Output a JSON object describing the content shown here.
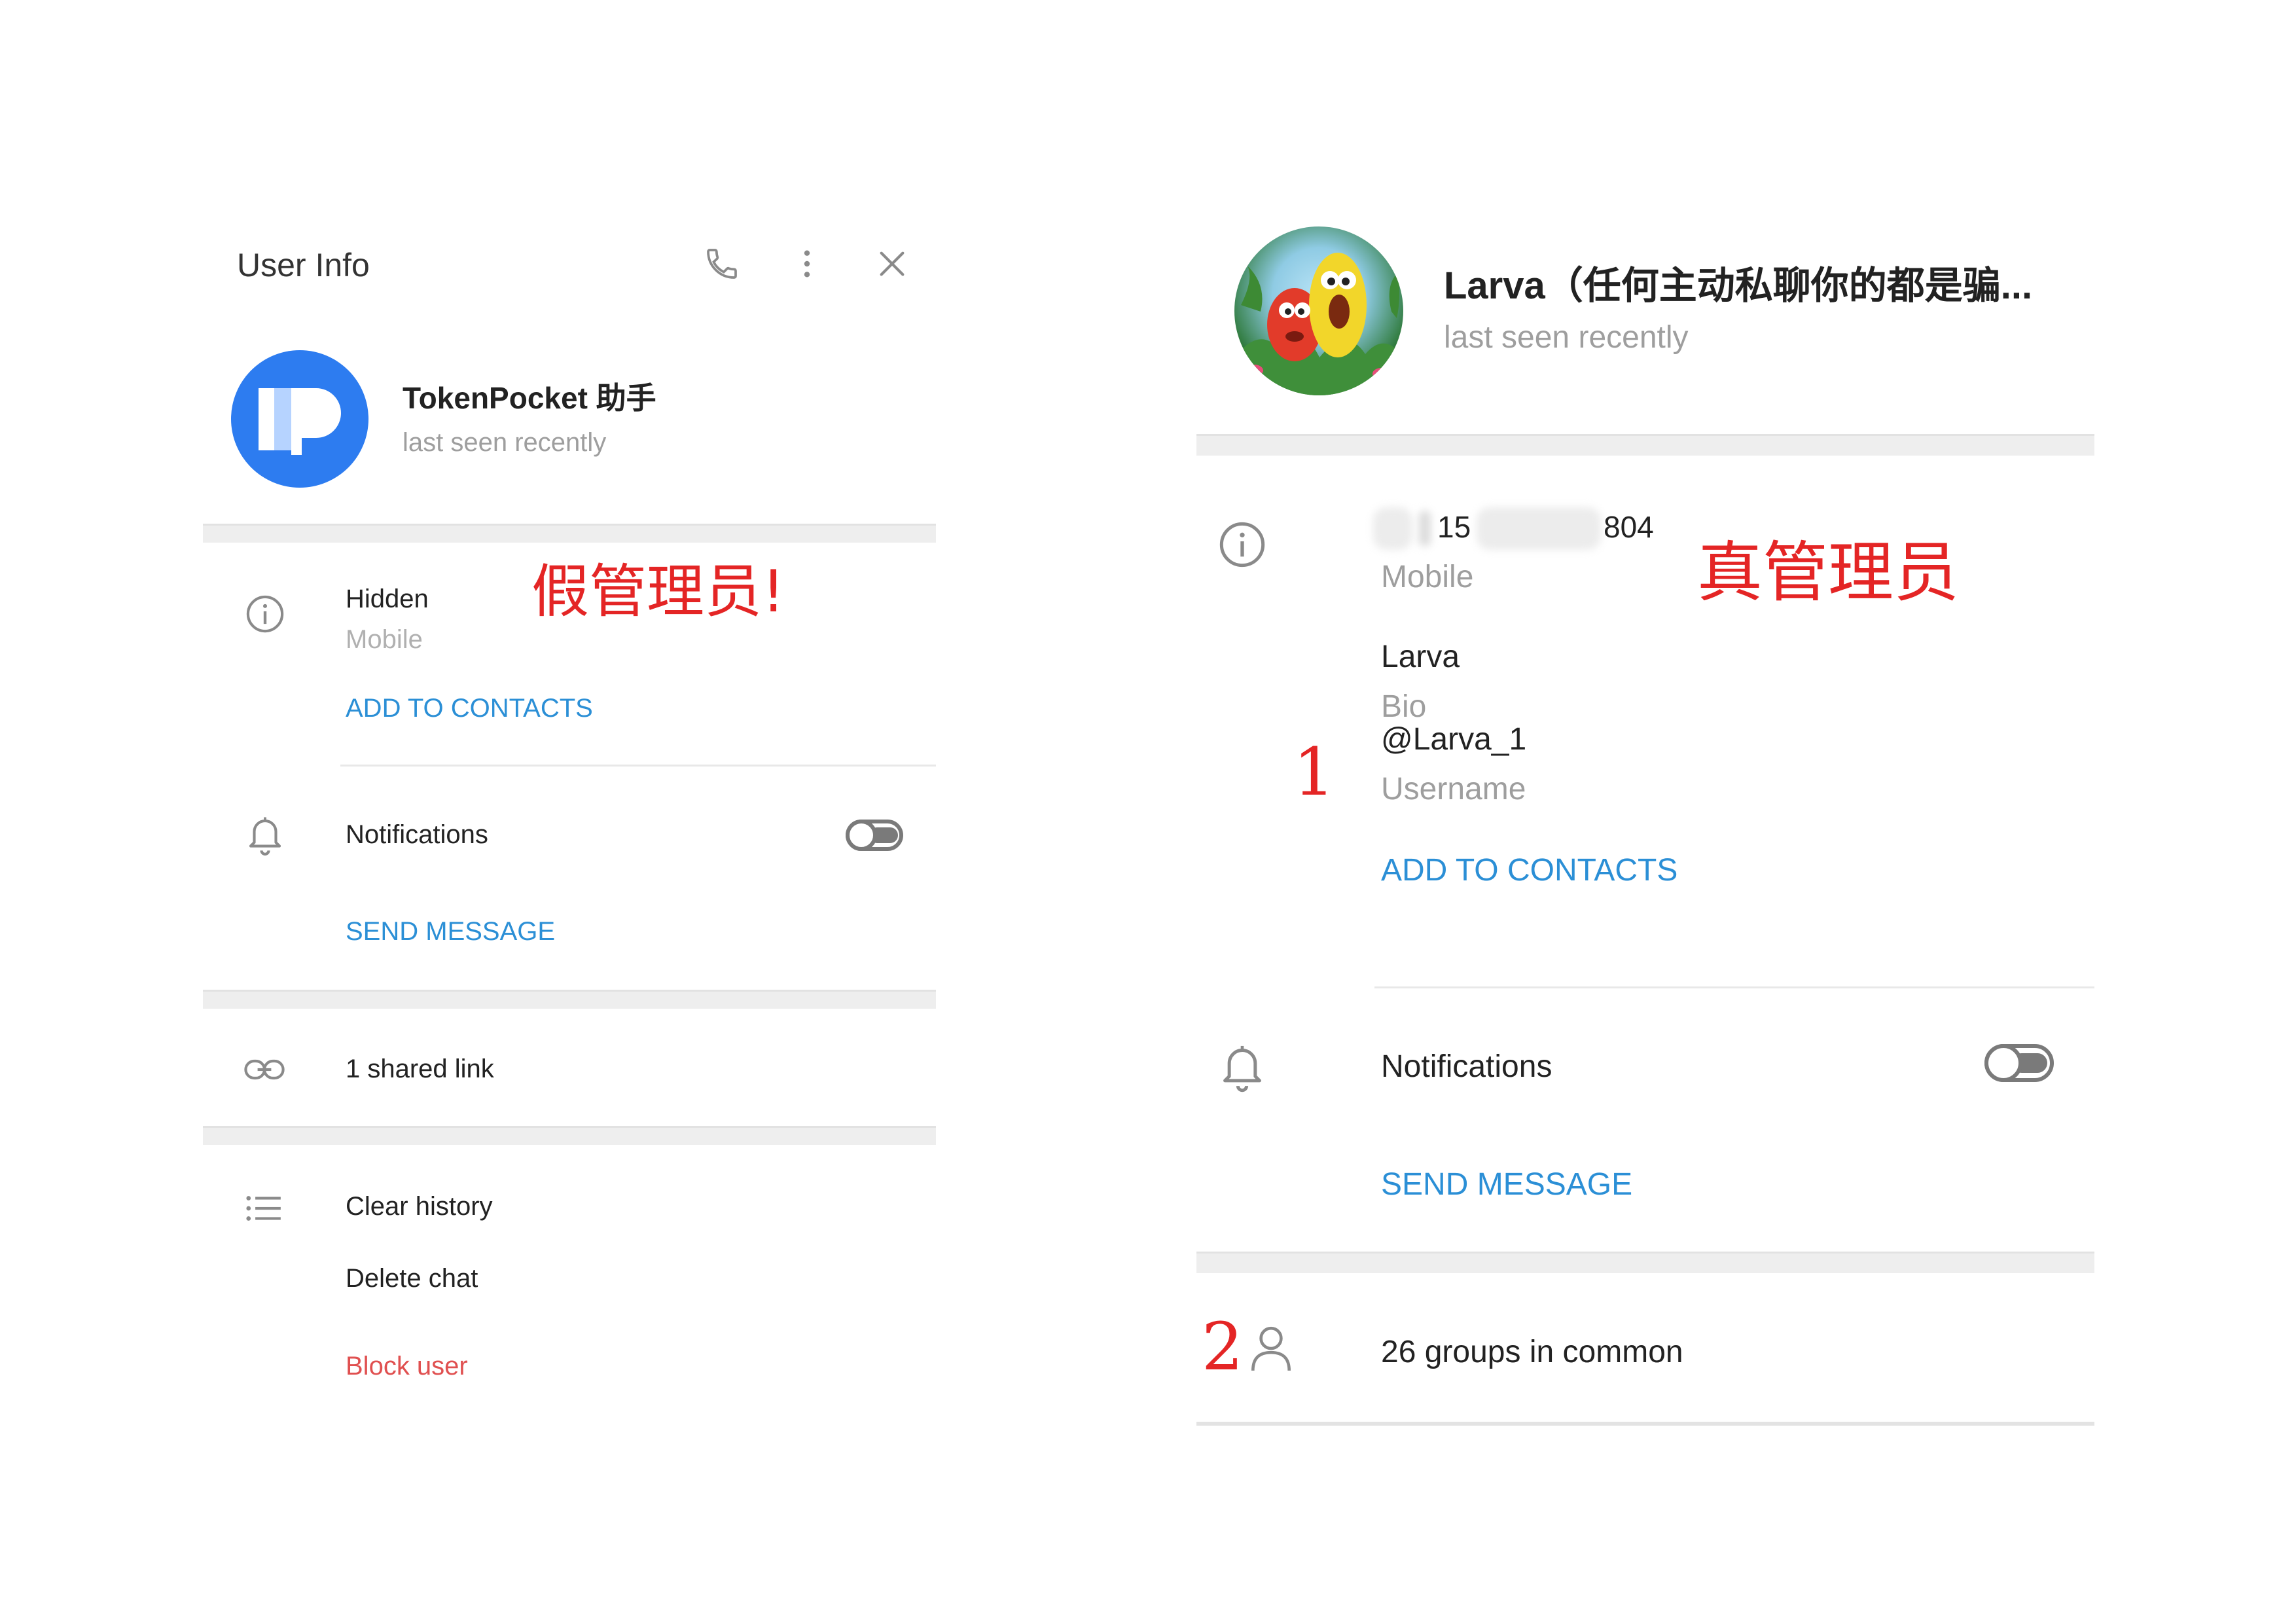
{
  "left_panel": {
    "header_title": "User Info",
    "name": "TokenPocket 助手",
    "status": "last seen recently",
    "mobile_value": "Hidden",
    "mobile_label": "Mobile",
    "add_to_contacts": "ADD TO CONTACTS",
    "notifications": "Notifications",
    "notifications_on": false,
    "send_message": "SEND MESSAGE",
    "shared_links": "1 shared link",
    "clear_history": "Clear history",
    "delete_chat": "Delete chat",
    "block_user": "Block user",
    "annotation": "假管理员!",
    "colors": {
      "accent": "#2b8fd6",
      "danger": "#e05050",
      "avatar_bg": "#2d7cf0"
    }
  },
  "right_panel": {
    "name": "Larva（任何主动私聊你的都是骗...",
    "status": "last seen recently",
    "phone_visible_start": "15",
    "phone_visible_end": "804",
    "phone_label": "Mobile",
    "bio_value": "Larva",
    "bio_label": "Bio",
    "username_value": "@Larva_1",
    "username_label": "Username",
    "add_to_contacts": "ADD TO CONTACTS",
    "notifications": "Notifications",
    "notifications_on": false,
    "send_message": "SEND MESSAGE",
    "groups_in_common": "26 groups in common",
    "annotation": "真管理员",
    "marker_1": "1",
    "marker_2": "2"
  },
  "icons": {
    "phone": "phone-icon",
    "more": "more-vertical-icon",
    "close": "close-icon",
    "info": "info-icon",
    "bell": "bell-icon",
    "link": "link-icon",
    "list": "list-icon",
    "user": "user-icon"
  }
}
